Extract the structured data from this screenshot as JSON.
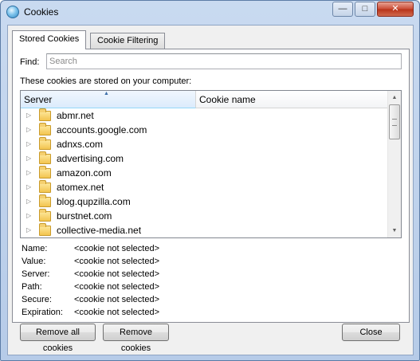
{
  "window": {
    "title": "Cookies"
  },
  "window_controls": {
    "minimize": "—",
    "maximize": "□",
    "close": "✕"
  },
  "tabs": [
    {
      "label": "Stored Cookies",
      "active": true
    },
    {
      "label": "Cookie Filtering",
      "active": false
    }
  ],
  "find": {
    "label": "Find:",
    "placeholder": "Search",
    "value": ""
  },
  "description": "These cookies are stored on your computer:",
  "tree": {
    "columns": [
      "Server",
      "Cookie name"
    ],
    "sort_column": "Server",
    "rows": [
      "abmr.net",
      "accounts.google.com",
      "adnxs.com",
      "advertising.com",
      "amazon.com",
      "atomex.net",
      "blog.qupzilla.com",
      "burstnet.com",
      "collective-media.net"
    ]
  },
  "details": [
    {
      "label": "Name:",
      "value": "<cookie not selected>"
    },
    {
      "label": "Value:",
      "value": "<cookie not selected>"
    },
    {
      "label": "Server:",
      "value": "<cookie not selected>"
    },
    {
      "label": "Path:",
      "value": "<cookie not selected>"
    },
    {
      "label": "Secure:",
      "value": "<cookie not selected>"
    },
    {
      "label": "Expiration:",
      "value": "<cookie not selected>"
    }
  ],
  "buttons": {
    "remove_all": "Remove all cookies",
    "remove": "Remove cookies",
    "close": "Close"
  },
  "colors": {
    "titlebar": "#c9daf0",
    "folder": "#f3c44f",
    "close_button": "#c94a33"
  }
}
